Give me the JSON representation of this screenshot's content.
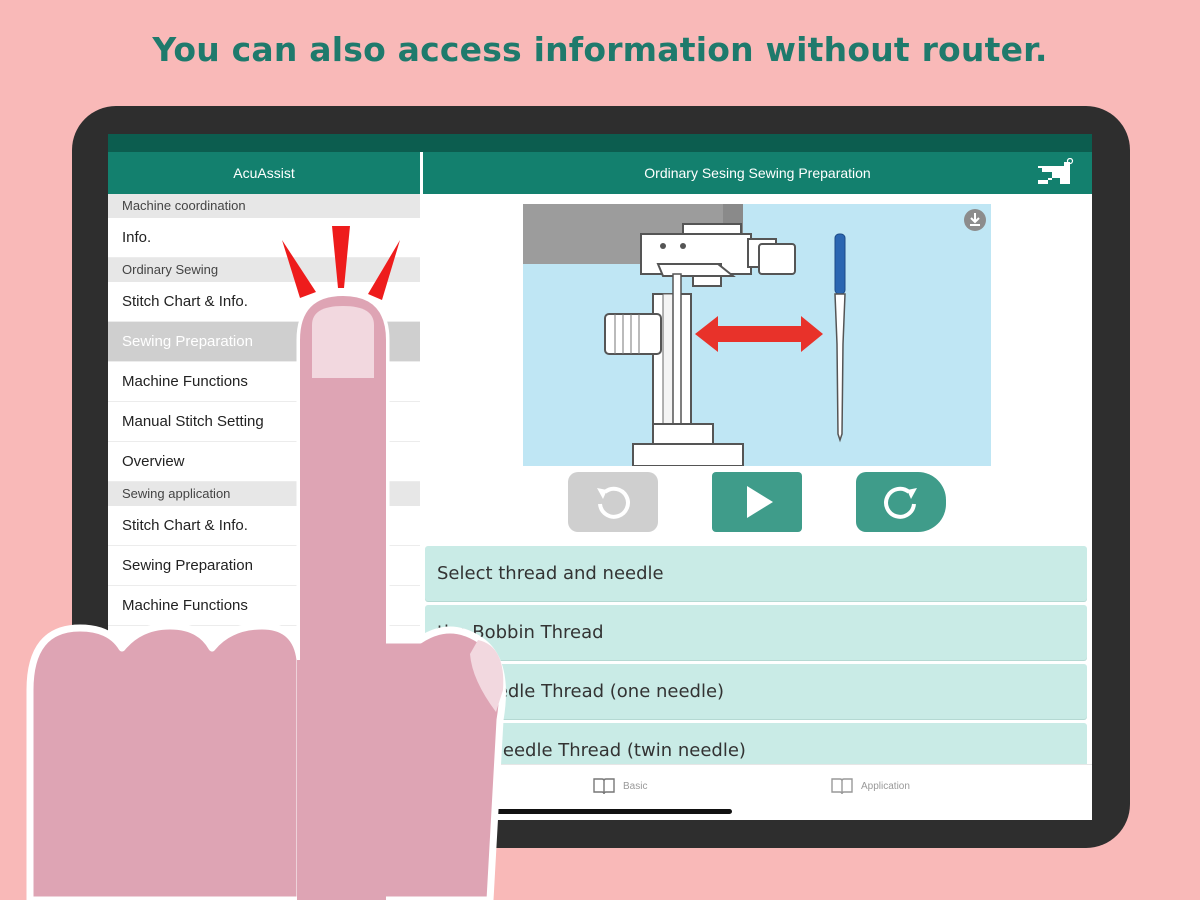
{
  "headline": "You can also access information without router.",
  "app": {
    "left_title": "AcuAssist",
    "right_title": "Ordinary Sesing Sewing Preparation"
  },
  "sidebar": {
    "sections": [
      {
        "title": "Machine coordination",
        "items": [
          {
            "label": "Info."
          }
        ]
      },
      {
        "title": "Ordinary Sewing",
        "items": [
          {
            "label": "Stitch Chart & Info."
          },
          {
            "label": "Sewing Preparation",
            "selected": true
          },
          {
            "label": "Machine Functions"
          },
          {
            "label": "Manual Stitch Setting"
          },
          {
            "label": "Overview"
          }
        ]
      },
      {
        "title": "Sewing application",
        "items": [
          {
            "label": "Stitch Chart & Info."
          },
          {
            "label": "Sewing Preparation"
          },
          {
            "label": "Machine Functions"
          }
        ]
      }
    ]
  },
  "player": {
    "rewind_icon": "replay-icon",
    "play_icon": "play-icon",
    "forward_icon": "forward-icon",
    "download_icon": "download-icon"
  },
  "steps": [
    "Select thread and needle",
    "the Bobbin Thread",
    "the Needle Thread (one needle)",
    "g the Needle Thread (twin needle)"
  ],
  "tabs": {
    "basic": "Basic",
    "application": "Application"
  },
  "colors": {
    "background": "#f9b9b8",
    "headline": "#1f7a6c",
    "header": "#13806e",
    "step_bg": "#c9ebe6",
    "accent_button": "#3f9c8a",
    "finger": "#dea4b4"
  }
}
